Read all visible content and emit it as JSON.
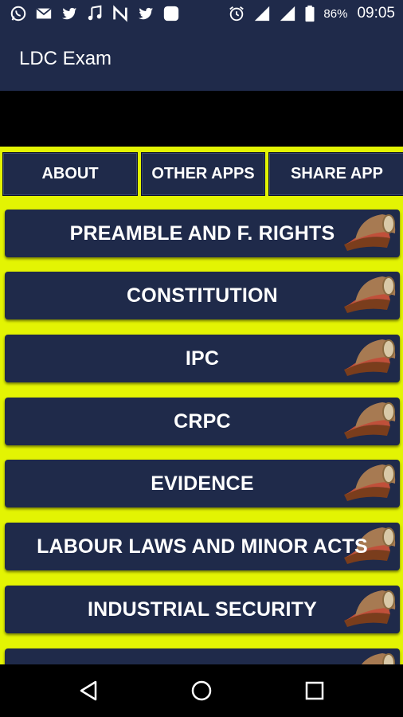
{
  "status_bar": {
    "battery_percent": "86%",
    "time": "09:05",
    "left_icons": [
      "whatsapp-icon",
      "mail-icon",
      "twitter-icon",
      "music-icon",
      "news-icon",
      "twitter-icon",
      "app-icon"
    ],
    "right_icons": [
      "alarm-icon",
      "signal-icon",
      "signal-icon",
      "battery-icon"
    ]
  },
  "app_bar": {
    "title": "LDC Exam"
  },
  "top_buttons": [
    {
      "label": "ABOUT"
    },
    {
      "label": "OTHER APPS"
    },
    {
      "label": "SHARE APP"
    }
  ],
  "menu_items": [
    {
      "label": "PREAMBLE AND F. RIGHTS"
    },
    {
      "label": "CONSTITUTION"
    },
    {
      "label": "IPC"
    },
    {
      "label": "CRPC"
    },
    {
      "label": "EVIDENCE"
    },
    {
      "label": "LABOUR LAWS AND MINOR ACTS"
    },
    {
      "label": "INDUSTRIAL SECURITY"
    },
    {
      "label": ""
    }
  ],
  "colors": {
    "primary": "#1f2a4a",
    "background": "#e3f403",
    "text": "#ffffff"
  }
}
